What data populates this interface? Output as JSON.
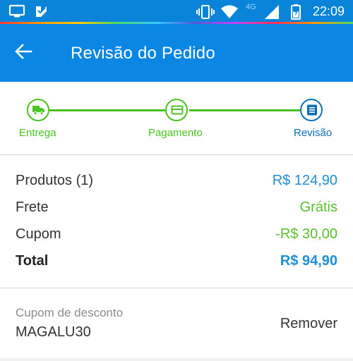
{
  "status_bar": {
    "time": "22:09",
    "network": "4G",
    "icons": [
      "screen-cast-icon",
      "notification-icon",
      "vibrate-icon",
      "wifi-icon",
      "signal-icon",
      "battery-icon"
    ]
  },
  "app_bar": {
    "back_icon": "arrow-back-icon",
    "title": "Revisão do Pedido"
  },
  "stepper": {
    "steps": [
      {
        "label": "Entrega",
        "icon": "truck-icon",
        "state": "completed"
      },
      {
        "label": "Pagamento",
        "icon": "credit-card-icon",
        "state": "completed"
      },
      {
        "label": "Revisão",
        "icon": "list-icon",
        "state": "current"
      }
    ]
  },
  "summary": {
    "products_label": "Produtos (1)",
    "products_value": "R$ 124,90",
    "shipping_label": "Frete",
    "shipping_value": "Grátis",
    "coupon_label": "Cupom",
    "coupon_value": "-R$ 30,00",
    "total_label": "Total",
    "total_value": "R$ 94,90"
  },
  "coupon": {
    "caption": "Cupom de desconto",
    "code": "MAGALU30",
    "remove_label": "Remover"
  },
  "colors": {
    "primary": "#0b86e3",
    "step_green": "#49c320",
    "step_blue": "#0b6fb8",
    "price_blue": "#1f8fd6",
    "free_green": "#5bbf2a"
  }
}
